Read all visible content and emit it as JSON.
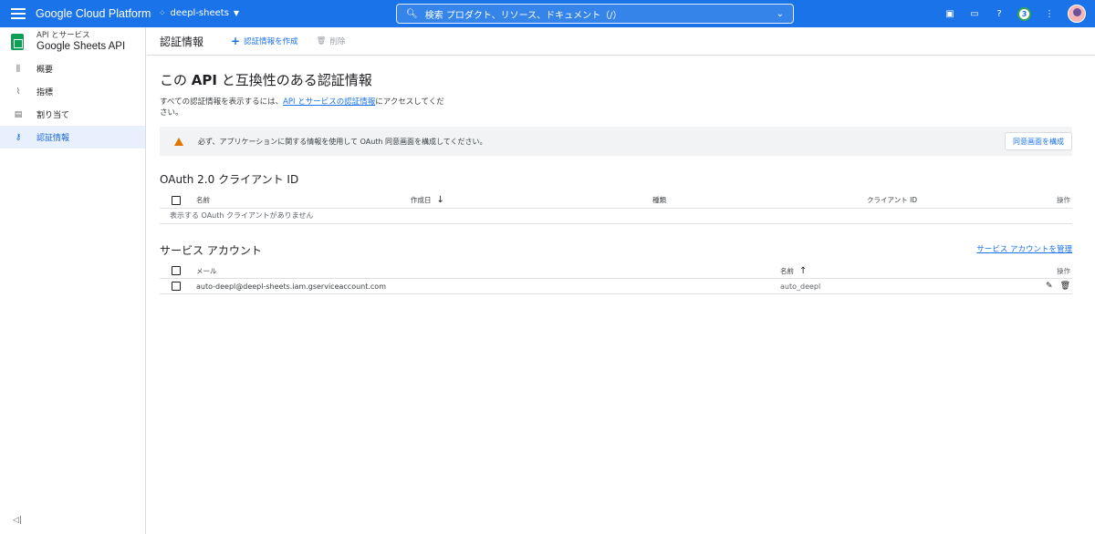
{
  "topbar": {
    "brand": "Google Cloud Platform",
    "project": "deepl-sheets",
    "search_placeholder": "検索 プロダクト、リソース、ドキュメント（/）",
    "notification_count": "3",
    "colors": {
      "bar": "#1a73e8"
    }
  },
  "sidebar": {
    "subtitle": "API とサービス",
    "title": "Google Sheets API",
    "items": [
      {
        "label": "概要",
        "icon": "dashboard-icon"
      },
      {
        "label": "指標",
        "icon": "metrics-icon"
      },
      {
        "label": "割り当て",
        "icon": "quota-icon"
      },
      {
        "label": "認証情報",
        "icon": "key-icon",
        "active": true
      }
    ]
  },
  "actionbar": {
    "title": "認証情報",
    "create_label": "認証情報を作成",
    "delete_label": "削除"
  },
  "main": {
    "heading_pre": "この ",
    "heading_bold": "API",
    "heading_post": " と互換性のある認証情報",
    "desc_pre": "すべての認証情報を表示するには、",
    "desc_link": "API とサービスの認証情報",
    "desc_post": "にアクセスしてください。",
    "warning_text": "必ず、アプリケーションに関する情報を使用して OAuth 同意画面を構成してください。",
    "warning_button": "同意画面を構成"
  },
  "oauth": {
    "section_title": "OAuth 2.0 クライアント ID",
    "columns": [
      "名前",
      "作成日",
      "種類",
      "クライアント ID",
      "操作"
    ],
    "empty_text": "表示する OAuth クライアントがありません"
  },
  "service_accounts": {
    "section_title": "サービス アカウント",
    "manage_link": "サービス アカウントを管理",
    "columns": [
      "メール",
      "名前",
      "操作"
    ],
    "rows": [
      {
        "email": "auto-deepl@deepl-sheets.iam.gserviceaccount.com",
        "name": "auto_deepl"
      }
    ]
  }
}
